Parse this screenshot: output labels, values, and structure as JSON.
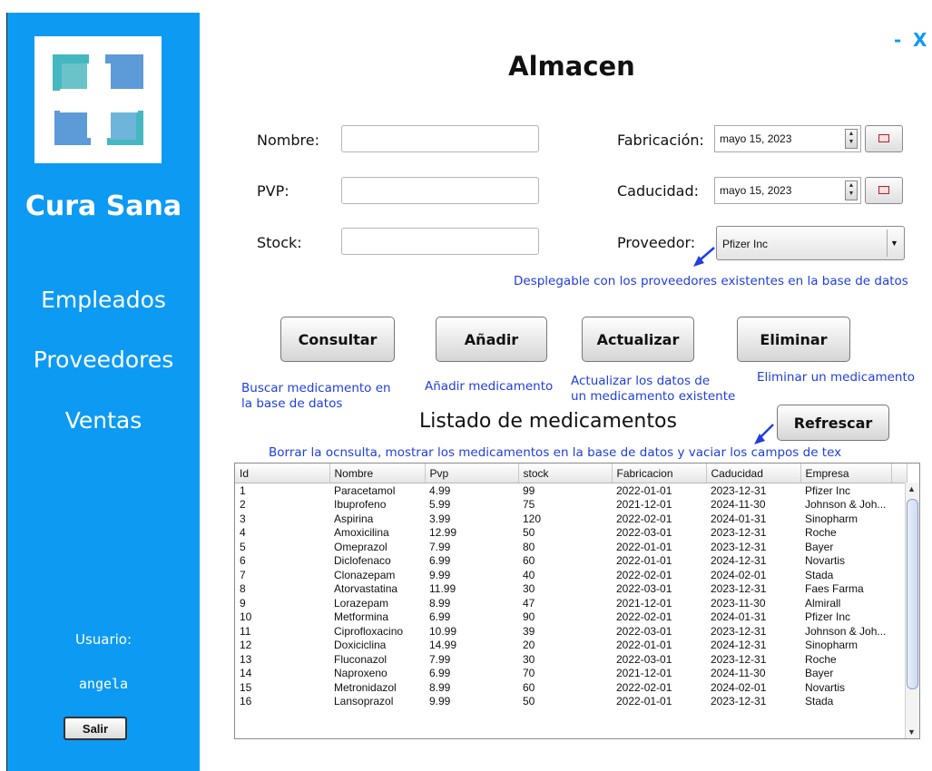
{
  "app": {
    "brand": "Cura Sana",
    "title": "Almacen",
    "minimize": "-",
    "close": "X"
  },
  "sidebar": {
    "nav": [
      {
        "label": "Empleados"
      },
      {
        "label": "Proveedores"
      },
      {
        "label": "Ventas"
      }
    ],
    "user_label": "Usuario:",
    "user_name": "angela",
    "logout_label": "Salir"
  },
  "form": {
    "nombre_label": "Nombre:",
    "pvp_label": "PVP:",
    "stock_label": "Stock:",
    "fabricacion_label": "Fabricación:",
    "fabricacion_value": "mayo 15, 2023",
    "caducidad_label": "Caducidad:",
    "caducidad_value": "mayo 15, 2023",
    "proveedor_label": "Proveedor:",
    "proveedor_value": "Pfizer Inc"
  },
  "notes": {
    "proveedor": "Desplegable con los proveedores existentes en la base de datos",
    "consultar_1": "Buscar medicamento en",
    "consultar_2": "la base de datos",
    "anadir": "Añadir medicamento",
    "actualizar_1": "Actualizar los datos de",
    "actualizar_2": "un medicamento existente",
    "eliminar": "Eliminar un medicamento",
    "refrescar": "Borrar la ocnsulta, mostrar los medicamentos en la base de datos y vaciar los campos de tex"
  },
  "buttons": {
    "consultar": "Consultar",
    "anadir": "Añadir",
    "actualizar": "Actualizar",
    "eliminar": "Eliminar",
    "refrescar": "Refrescar"
  },
  "list_title": "Listado de medicamentos",
  "table": {
    "columns": [
      "Id",
      "Nombre",
      "Pvp",
      "stock",
      "Fabricacion",
      "Caducidad",
      "Empresa"
    ],
    "rows": [
      [
        "1",
        "Paracetamol",
        "4.99",
        "99",
        "2022-01-01",
        "2023-12-31",
        "Pfizer Inc"
      ],
      [
        "2",
        "Ibuprofeno",
        "5.99",
        "75",
        "2021-12-01",
        "2024-11-30",
        "Johnson & Joh..."
      ],
      [
        "3",
        "Aspirina",
        "3.99",
        "120",
        "2022-02-01",
        "2024-01-31",
        "Sinopharm"
      ],
      [
        "4",
        "Amoxicilina",
        "12.99",
        "50",
        "2022-03-01",
        "2023-12-31",
        "Roche"
      ],
      [
        "5",
        "Omeprazol",
        "7.99",
        "80",
        "2022-01-01",
        "2023-12-31",
        "Bayer"
      ],
      [
        "6",
        "Diclofenaco",
        "6.99",
        "60",
        "2022-01-01",
        "2024-12-31",
        "Novartis"
      ],
      [
        "7",
        "Clonazepam",
        "9.99",
        "40",
        "2022-02-01",
        "2024-02-01",
        "Stada"
      ],
      [
        "8",
        "Atorvastatina",
        "11.99",
        "30",
        "2022-03-01",
        "2023-12-31",
        "Faes Farma"
      ],
      [
        "9",
        "Lorazepam",
        "8.99",
        "47",
        "2021-12-01",
        "2023-11-30",
        "Almirall"
      ],
      [
        "10",
        "Metformina",
        "6.99",
        "90",
        "2022-02-01",
        "2024-01-31",
        "Pfizer Inc"
      ],
      [
        "11",
        "Ciprofloxacino",
        "10.99",
        "39",
        "2022-03-01",
        "2023-12-31",
        "Johnson & Joh..."
      ],
      [
        "12",
        "Doxiciclina",
        "14.99",
        "20",
        "2022-01-01",
        "2024-12-31",
        "Sinopharm"
      ],
      [
        "13",
        "Fluconazol",
        "7.99",
        "30",
        "2022-03-01",
        "2023-12-31",
        "Roche"
      ],
      [
        "14",
        "Naproxeno",
        "6.99",
        "70",
        "2021-12-01",
        "2024-11-30",
        "Bayer"
      ],
      [
        "15",
        "Metronidazol",
        "8.99",
        "60",
        "2022-02-01",
        "2024-02-01",
        "Novartis"
      ],
      [
        "16",
        "Lansoprazol",
        "9.99",
        "50",
        "2022-01-01",
        "2023-12-31",
        "Stada"
      ]
    ]
  },
  "colors": {
    "sidebar": "#0d9af3",
    "note": "#1f3ee0",
    "logo_teal": "#45b7c0",
    "logo_blue": "#5d9ad8"
  }
}
